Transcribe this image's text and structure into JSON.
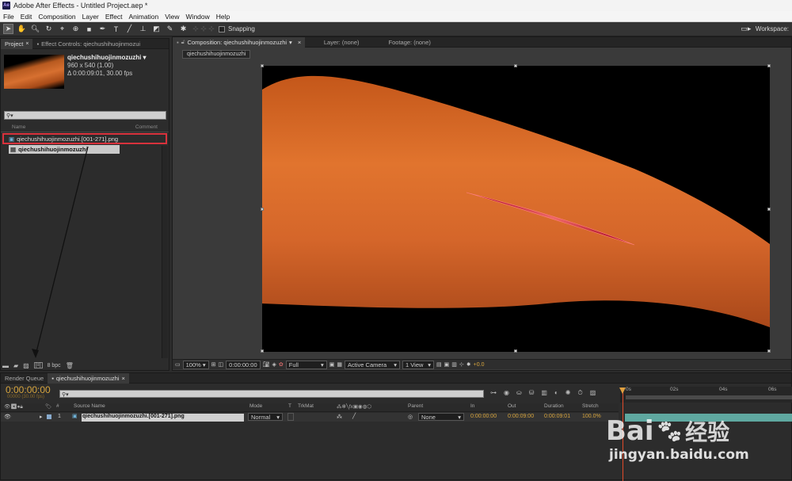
{
  "window": {
    "title": "Adobe After Effects - Untitled Project.aep *"
  },
  "menu": [
    "File",
    "Edit",
    "Composition",
    "Layer",
    "Effect",
    "Animation",
    "View",
    "Window",
    "Help"
  ],
  "toolbar": {
    "snapping_label": "Snapping",
    "workspace_label": "Workspace:"
  },
  "project_panel": {
    "tab_project": "Project",
    "tab_effect_controls": "Effect Controls: qiechushihuojinmozui",
    "comp_name": "qiechushihuojinmozuzhi ▾",
    "comp_size": "960 x 540 (1.00)",
    "comp_duration": "Δ 0:00:09:01, 30.00 fps",
    "search_placeholder": "",
    "col_name": "Name",
    "col_comment": "Comment",
    "items": [
      {
        "name": "qiechushihuojinmozuzhi.[001-271].png",
        "type": "footage",
        "highlighted": true
      },
      {
        "name": "qiechushihuojinmozuzhi",
        "type": "composition",
        "selected": true
      }
    ],
    "bpc_label": "8 bpc"
  },
  "comp_panel": {
    "tab_composition": "Composition: qiechushihuojinmozuzhi",
    "tab_layer": "Layer: (none)",
    "tab_footage": "Footage: (none)",
    "comp_chip": "qiechushihuojinmozuzhi",
    "zoom": "100%",
    "timecode": "0:00:00:00",
    "resolution": "Full",
    "camera": "Active Camera",
    "views": "1 View",
    "exposure": "+0.0"
  },
  "timeline": {
    "tab_render_queue": "Render Queue",
    "tab_comp": "qiechushihuojinmozuzhi",
    "current_time": "0:00:00:00",
    "frame_info": "00000 (30.00 fps)",
    "columns": {
      "source_name": "Source Name",
      "mode": "Mode",
      "t": "T",
      "trkmat": "TrkMat",
      "parent": "Parent",
      "in": "In",
      "out": "Out",
      "duration": "Duration",
      "stretch": "Stretch",
      "num": "#"
    },
    "ruler_marks": [
      "0s",
      "02s",
      "04s",
      "06s"
    ],
    "layers": [
      {
        "num": "1",
        "name": "qiechushihuojinmozuzhi.[001-271].png",
        "mode": "Normal",
        "parent": "None",
        "in": "0:00:00:00",
        "out": "0:00:09:00",
        "duration": "0:00:09:01",
        "stretch": "100.0%"
      }
    ]
  },
  "watermark": {
    "brand": "Bai",
    "brand2": "经验",
    "url": "jingyan.baidu.com"
  },
  "colors": {
    "accent_orange": "#d7a53e",
    "highlight_red": "#d8323c",
    "timeline_bar": "#5fa8a0"
  }
}
